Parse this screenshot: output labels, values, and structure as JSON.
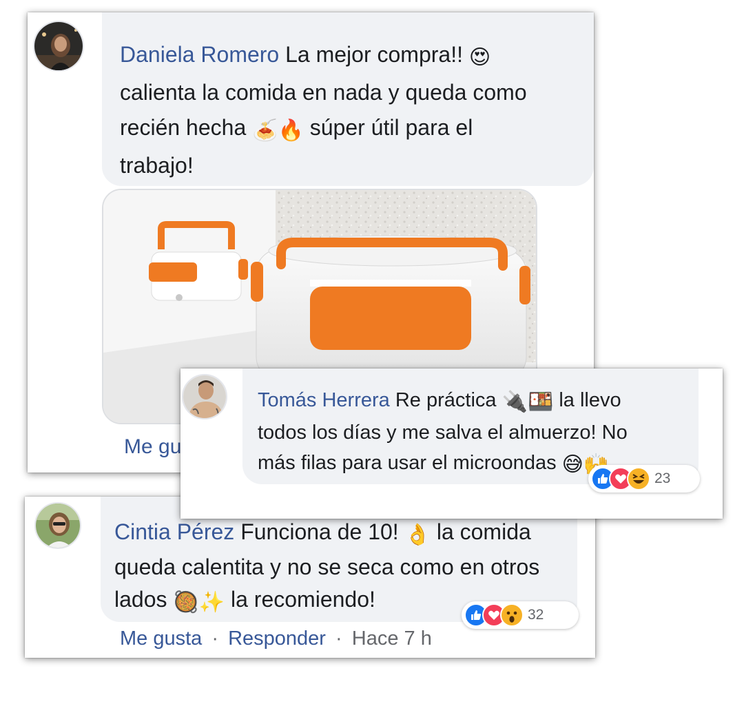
{
  "comments": [
    {
      "author": "Daniela Romero",
      "text_line1": "La mejor compra!!",
      "emoji_1": "😍",
      "text_line2": "calienta la comida en nada y queda como",
      "text_line3a": "recién hecha",
      "emoji_2": "🍝",
      "emoji_3": "🔥",
      "text_line3b": "súper útil para el",
      "text_line4": "trabajo!",
      "photo": "electric-lunchbox-photo",
      "actions": {
        "like": "Me gu"
      }
    },
    {
      "author": "Tomás Herrera",
      "text_line1a": "Re práctica",
      "emoji_1": "🔌",
      "emoji_2": "🍱",
      "text_line1b": "la llevo",
      "text_line2": "todos los días y me salva el almuerzo! No",
      "text_line3": "más filas para usar el microondas",
      "emoji_3": "😅",
      "emoji_4": "🙌",
      "reactions": {
        "count": "23",
        "icons": [
          "like-icon",
          "love-icon",
          "laugh-icon"
        ]
      }
    },
    {
      "author": "Cintia Pérez",
      "text_line1a": "Funciona de 10!",
      "emoji_1": "👌",
      "text_line1b": "la comida",
      "text_line2": "queda calentita y no se seca como en otros",
      "text_line3a": "lados",
      "emoji_2": "🥘",
      "emoji_3": "✨",
      "text_line3b": "la recomiendo!",
      "reactions": {
        "count": "32",
        "icons": [
          "like-icon",
          "love-icon",
          "wow-icon"
        ]
      },
      "actions": {
        "like": "Me gusta",
        "dot": "·",
        "reply": "Responder",
        "time": "Hace 7 h"
      }
    }
  ],
  "colors": {
    "name": "#385898",
    "bubble": "#f0f2f5",
    "like": "#1877f2",
    "love": "#f33e58",
    "haha": "#f7b125"
  }
}
